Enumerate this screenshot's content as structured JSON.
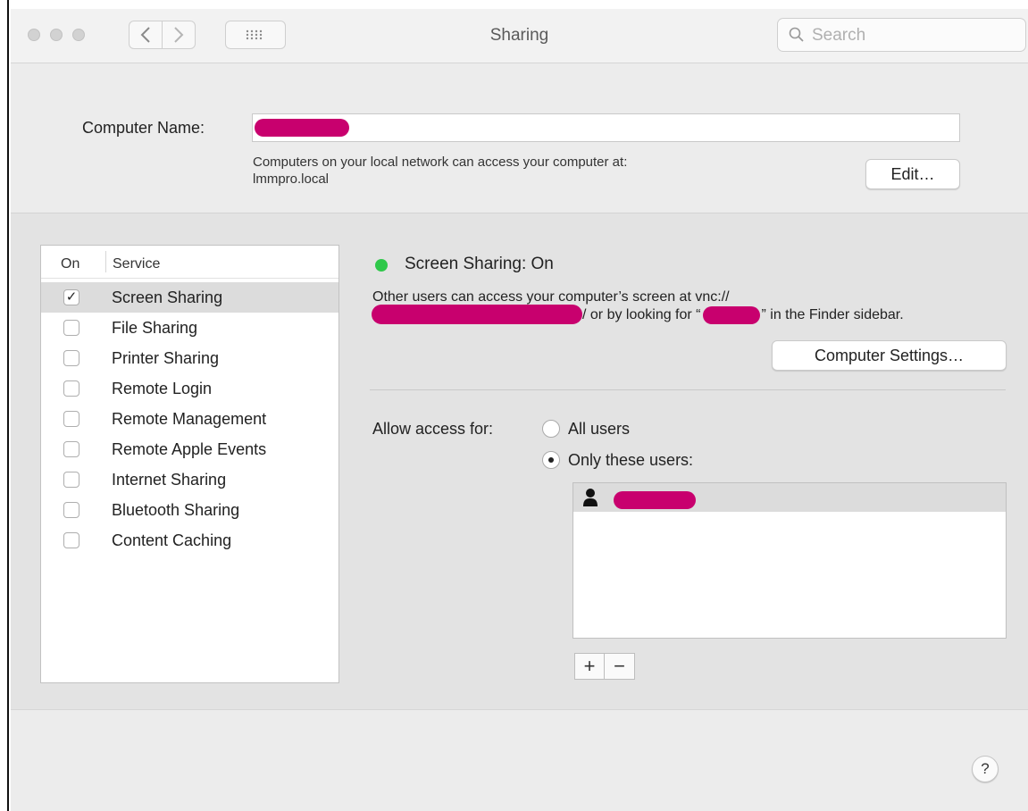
{
  "window": {
    "title": "Sharing",
    "search_placeholder": "Search"
  },
  "header": {
    "computer_name_label": "Computer Name:",
    "description_line1": "Computers on your local network can access your computer at:",
    "description_line2": "lmmpro.local",
    "edit_button": "Edit…"
  },
  "services": {
    "col_on": "On",
    "col_service": "Service",
    "items": [
      {
        "label": "Screen Sharing",
        "checked": true,
        "selected": true
      },
      {
        "label": "File Sharing",
        "checked": false
      },
      {
        "label": "Printer Sharing",
        "checked": false
      },
      {
        "label": "Remote Login",
        "checked": false
      },
      {
        "label": "Remote Management",
        "checked": false
      },
      {
        "label": "Remote Apple Events",
        "checked": false
      },
      {
        "label": "Internet Sharing",
        "checked": false
      },
      {
        "label": "Bluetooth Sharing",
        "checked": false
      },
      {
        "label": "Content Caching",
        "checked": false
      }
    ]
  },
  "detail": {
    "status_text": "Screen Sharing: On",
    "status_color": "#2fc84a",
    "info_line1": "Other users can access your computer’s screen at vnc://",
    "info_line2_part1": "/ or by looking for “",
    "info_line2_part2": "” in the Finder sidebar.",
    "computer_settings_button": "Computer Settings…",
    "allow_access_label": "Allow access for:",
    "radio_all_users": "All users",
    "radio_only_these": "Only these users:",
    "selected_option": "only_these_users",
    "add_button": "+",
    "remove_button": "−"
  },
  "icons": {
    "close": "traffic-light-close",
    "minimize": "traffic-light-minimize",
    "zoom": "traffic-light-zoom",
    "back": "chevron-left",
    "forward": "chevron-right",
    "grid": "show-all-grid",
    "search": "magnifying-glass",
    "user": "person-silhouette",
    "help": "question-mark"
  },
  "help_label": "?",
  "colors": {
    "redaction": "#c8006e",
    "window_bg": "#ececec",
    "content_bg": "#e3e3e3"
  }
}
